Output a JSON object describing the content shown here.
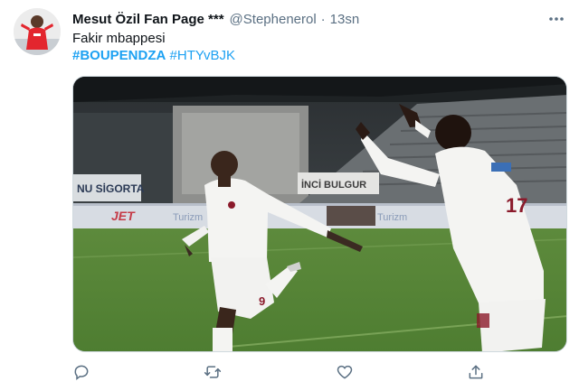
{
  "tweet": {
    "author_name": "Mesut Özil Fan Page ***",
    "author_handle": "@Stephenerol",
    "separator": "·",
    "time": "13sn",
    "text": "Fakir mbappesi",
    "hashtags": [
      "#BOUPENDZA",
      "#HTYvBJK"
    ],
    "media": {
      "stadium_signs": [
        "NU SİGORTA",
        "İNCİ BULGUR",
        "JET",
        "Turizm",
        "Turizm"
      ],
      "player_left_number": "9",
      "player_right_number": "17"
    }
  },
  "actions": {
    "reply_icon": "reply-icon",
    "retweet_icon": "retweet-icon",
    "like_icon": "like-icon",
    "share_icon": "share-icon"
  },
  "colors": {
    "hashtag": "#1da1f2",
    "secondary_text": "#5b7083",
    "pitch": "#5c8a3a",
    "kit": "#f4f4f2",
    "kit_accent": "#8b1a2b"
  }
}
